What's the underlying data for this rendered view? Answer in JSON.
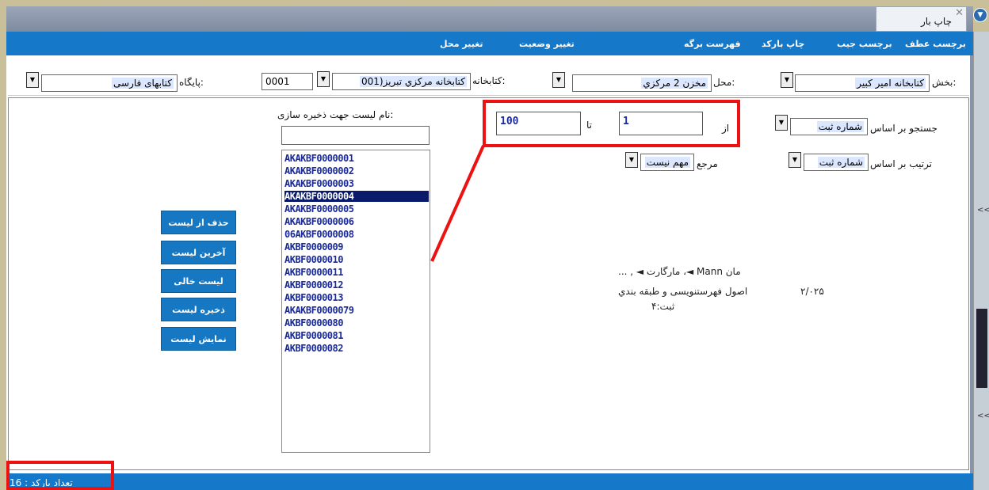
{
  "window": {
    "tab_title": "چاپ بار",
    "close_glyph": "✕"
  },
  "menu": {
    "items": [
      "برچسب عطف",
      "برچسب جیب",
      "چاپ بارکد",
      "فهرست برگه",
      "تغییر وضعیت",
      "تغییر محل"
    ]
  },
  "filters": {
    "section_label": "بخش:",
    "section_value": "كتابخانه امير كبير",
    "location_label": "محل:",
    "location_value": "مخزن 2 مركزي",
    "library_label": "كتابخانه:",
    "library_value": "كتابخانه مركزي تبريز(001",
    "library_code": "0001",
    "base_label": "پايگاه:",
    "base_value": "كتابهای فارسی"
  },
  "search": {
    "search_by_label": "جستجو بر اساس",
    "search_by_value": "شماره ثبت",
    "sort_by_label": "ترتیب بر اساس",
    "sort_by_value": "شماره ثبت",
    "from_label": "از",
    "from_value": "1",
    "to_label": "تا",
    "to_value": "100",
    "reference_label": "مرجع",
    "reference_value": "مهم نیست"
  },
  "save_list": {
    "label": "نام لیست جهت ذخیره سازی:",
    "input_value": ""
  },
  "list": {
    "items": [
      "AKAKBF0000001",
      "AKAKBF0000002",
      "AKAKBF0000003",
      "AKAKBF0000004",
      "AKAKBF0000005",
      "AKAKBF0000006",
      "06AKBF0000008",
      "AKBF0000009",
      "AKBF0000010",
      "AKBF0000011",
      "AKBF0000012",
      "AKBF0000013",
      "AKAKBF0000079",
      "AKBF0000080",
      "AKBF0000081",
      "AKBF0000082"
    ],
    "selected_index": 3
  },
  "buttons": {
    "remove": "حذف از لیست",
    "last": "آخرین لیست",
    "empty": "لیست خالی",
    "save": "ذخیره لیست",
    "show": "نمایش لیست"
  },
  "record": {
    "line1": "مان Mann ◄، مارگارت ◄ , ...",
    "title": "اصول فهرستنویسی و طبقه بندي",
    "callno": "۲/۰۲۵",
    "reg": "ثبت:۴"
  },
  "status": {
    "barcode_count": "تعداد بارکد : 16"
  },
  "colors": {
    "accent": "#1578c8",
    "highlight": "#e11111",
    "list_text": "#1a2a9c"
  }
}
